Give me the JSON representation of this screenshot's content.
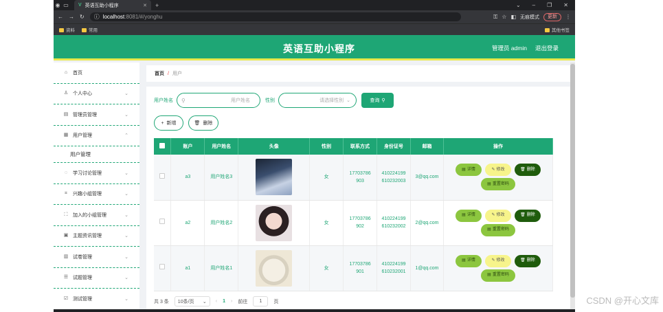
{
  "browser": {
    "tab_title": "英语互助小程序",
    "url_host": "localhost",
    "url_path": ":8081/#/yonghu",
    "incognito_label": "无痕模式",
    "update_label": "更新",
    "bookmarks": [
      "资料",
      "常用"
    ],
    "bookmarks_right": "其他书签"
  },
  "header": {
    "title": "英语互助小程序",
    "user": "管理员 admin",
    "logout": "退出登录",
    "color": "#1ea675"
  },
  "sidebar": {
    "items": [
      {
        "label": "首页",
        "icon": "home-icon"
      },
      {
        "label": "个人中心",
        "icon": "user-icon"
      },
      {
        "label": "管理员管理",
        "icon": "admin-icon"
      },
      {
        "label": "用户管理",
        "icon": "grid-icon"
      },
      {
        "label": "学习讨论管理",
        "icon": "chat-icon"
      },
      {
        "label": "兴趣小组管理",
        "icon": "crop-icon"
      },
      {
        "label": "加入的小组管理",
        "icon": "frame-icon"
      },
      {
        "label": "主题资讯管理",
        "icon": "news-icon"
      },
      {
        "label": "试卷管理",
        "icon": "paper-icon"
      },
      {
        "label": "试题管理",
        "icon": "question-icon"
      },
      {
        "label": "测试管理",
        "icon": "test-icon"
      }
    ],
    "sub_item": "用户管理"
  },
  "breadcrumb": {
    "home": "首页",
    "sep": "/",
    "current": "用户"
  },
  "search": {
    "name_label": "用户姓名",
    "name_placeholder": "用户姓名",
    "gender_label": "性别",
    "gender_placeholder": "请选择性别",
    "search_button": "查询"
  },
  "actions": {
    "add": "新增",
    "delete": "删除"
  },
  "table": {
    "headers": [
      "账户",
      "用户姓名",
      "头像",
      "性别",
      "联系方式",
      "身份证号",
      "邮箱",
      "操作"
    ],
    "rows": [
      {
        "account": "a3",
        "name": "用户姓名3",
        "gender": "女",
        "phone": "17703786903",
        "idcard": "410224199610232003",
        "email": "3@qq.com"
      },
      {
        "account": "a2",
        "name": "用户姓名2",
        "gender": "女",
        "phone": "17703786902",
        "idcard": "410224199610232002",
        "email": "2@qq.com"
      },
      {
        "account": "a1",
        "name": "用户姓名1",
        "gender": "女",
        "phone": "17703786901",
        "idcard": "410224199610232001",
        "email": "1@qq.com"
      }
    ],
    "ops": {
      "view": "详情",
      "edit": "修改",
      "del": "删除",
      "reset": "重置密码"
    }
  },
  "pager": {
    "total": "共 3 条",
    "size": "10条/页",
    "page": "1",
    "goto": "前往",
    "goto_value": "1",
    "page_unit": "页"
  },
  "watermark": "CSDN @开心文库"
}
